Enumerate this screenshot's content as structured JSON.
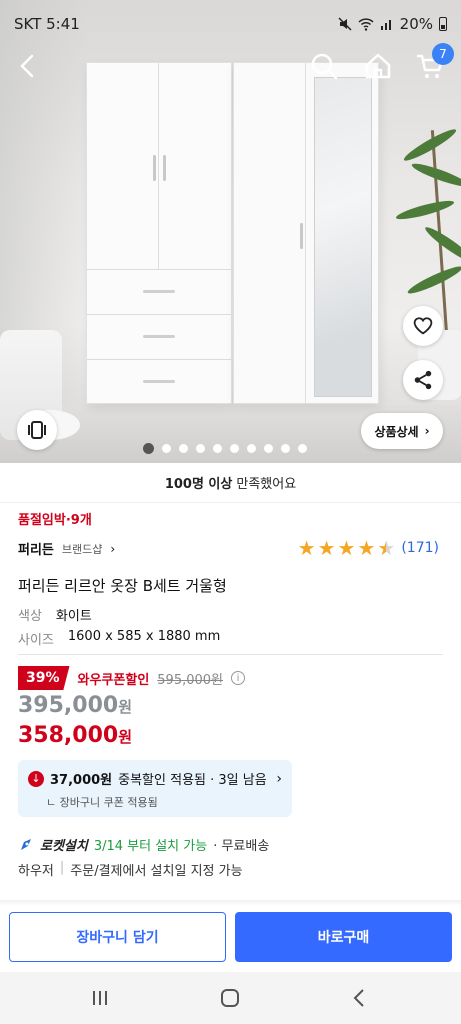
{
  "status_bar": {
    "carrier_time": "SKT 5:41",
    "battery": "20%"
  },
  "top_nav": {
    "cart_count": "7"
  },
  "hero": {
    "detail_button": "상품상세",
    "image_count": 10,
    "active_index": 0
  },
  "satisfaction": {
    "bold": "100명 이상",
    "rest": "만족했어요"
  },
  "product": {
    "low_stock": "품절임박·9개",
    "brand": "퍼리든",
    "brand_shop": "브랜드샵",
    "rating": 4.5,
    "review_count": "(171)",
    "title": "퍼리든 리르안 옷장 B세트 거울형",
    "options": [
      {
        "key": "색상",
        "value": "화이트"
      },
      {
        "key": "사이즈",
        "value": "1600 x 585 x 1880 mm"
      }
    ]
  },
  "pricing": {
    "discount_pct": "39%",
    "coupon_label": "와우쿠폰할인",
    "original_price": "595,000원",
    "price_before": "395,000",
    "price_final": "358,000",
    "currency": "원"
  },
  "coupon_box": {
    "amount": "37,000원",
    "text": "중복할인 적용됨 · 3일 남음",
    "sub": "ㄴ 장바구니 쿠폰 적용됨"
  },
  "delivery": {
    "rocket_label": "로켓설치",
    "date": "3/14 부터 설치 가능",
    "free": "· 무료배송",
    "install_a": "하우저",
    "install_b": "주문/결제에서 설치일 지정 가능"
  },
  "buttons": {
    "cart": "장바구니 담기",
    "buy": "바로구매"
  },
  "colors": {
    "accent_blue": "#346aff",
    "sale_red": "#d0021b",
    "rocket_green": "#1a9e3f"
  }
}
